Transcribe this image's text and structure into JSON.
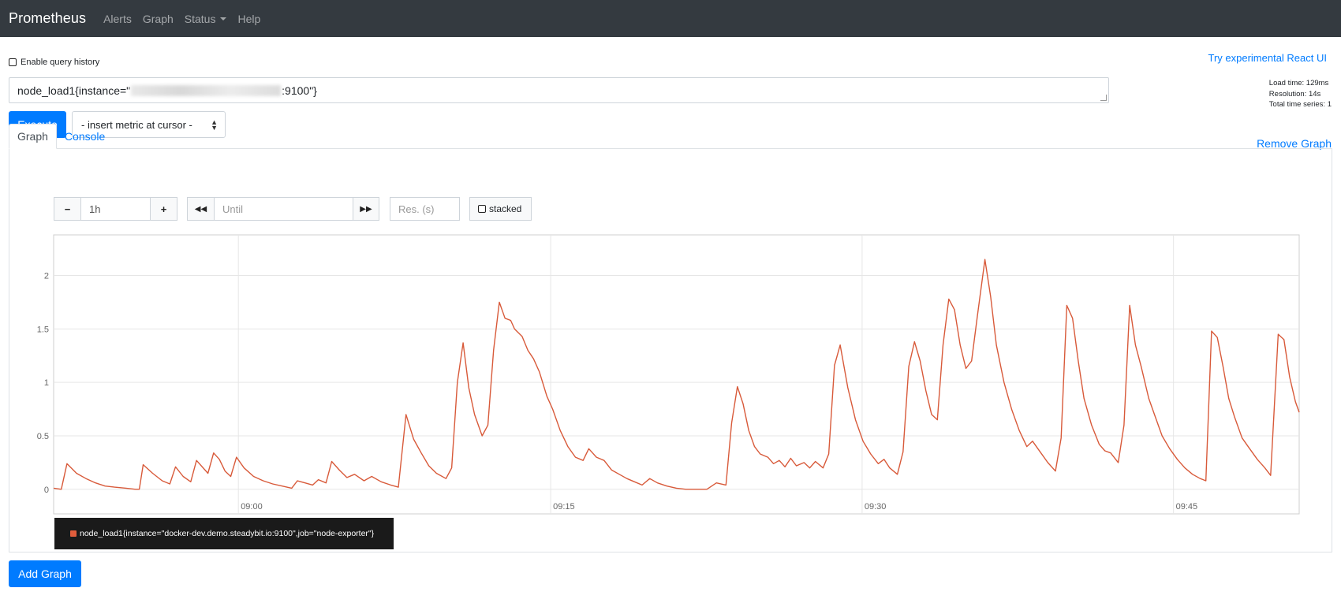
{
  "navbar": {
    "brand": "Prometheus",
    "links": [
      "Alerts",
      "Graph",
      "Status",
      "Help"
    ]
  },
  "query_history_label": "Enable query history",
  "react_ui_link": "Try experimental React UI",
  "stats": {
    "load_time": "Load time: 129ms",
    "resolution": "Resolution: 14s",
    "total_series": "Total time series: 1"
  },
  "expression": {
    "prefix": "node_load1{instance=\"",
    "suffix": ":9100\"}"
  },
  "execute_label": "Execute",
  "metric_select": "- insert metric at cursor -",
  "remove_graph_label": "Remove Graph",
  "tabs": [
    "Graph",
    "Console"
  ],
  "controls": {
    "range_value": "1h",
    "until_placeholder": "Until",
    "res_placeholder": "Res. (s)",
    "stacked_label": "stacked",
    "minus": "−",
    "plus": "+",
    "back": "◀◀",
    "forward": "▶▶"
  },
  "legend_label": "node_load1{instance=\"docker-dev.demo.steadybit.io:9100\",job=\"node-exporter\"}",
  "add_graph_label": "Add Graph",
  "colors": {
    "series": "#d85a3a",
    "accent": "#007bff",
    "navbar": "#343a40"
  },
  "chart_data": {
    "type": "line",
    "ylim": [
      -0.23,
      2.38
    ],
    "yticks": [
      0,
      0.5,
      1,
      1.5,
      2
    ],
    "ytick_labels": [
      "0",
      "0.5",
      "1",
      "1.5",
      "2"
    ],
    "xticks": [
      "09:00",
      "09:15",
      "09:30",
      "09:45"
    ],
    "series": [
      {
        "name": "node_load1{instance=\"docker-dev.demo.steadybit.io:9100\",job=\"node-exporter\"}",
        "points": [
          [
            0,
            0.01
          ],
          [
            0.4,
            0.0
          ],
          [
            0.7,
            0.24
          ],
          [
            1.2,
            0.15
          ],
          [
            1.7,
            0.1
          ],
          [
            2.2,
            0.06
          ],
          [
            2.7,
            0.03
          ],
          [
            3.2,
            0.02
          ],
          [
            3.8,
            0.01
          ],
          [
            4.3,
            0.0
          ],
          [
            4.5,
            0.0
          ],
          [
            4.7,
            0.23
          ],
          [
            5.2,
            0.15
          ],
          [
            5.7,
            0.08
          ],
          [
            6.1,
            0.05
          ],
          [
            6.4,
            0.21
          ],
          [
            6.8,
            0.12
          ],
          [
            7.2,
            0.07
          ],
          [
            7.5,
            0.27
          ],
          [
            8.1,
            0.15
          ],
          [
            8.4,
            0.34
          ],
          [
            8.7,
            0.28
          ],
          [
            9.0,
            0.17
          ],
          [
            9.3,
            0.12
          ],
          [
            9.6,
            0.3
          ],
          [
            10.0,
            0.2
          ],
          [
            10.5,
            0.12
          ],
          [
            11.0,
            0.08
          ],
          [
            11.5,
            0.05
          ],
          [
            12.0,
            0.03
          ],
          [
            12.5,
            0.01
          ],
          [
            12.8,
            0.08
          ],
          [
            13.2,
            0.06
          ],
          [
            13.6,
            0.04
          ],
          [
            13.9,
            0.09
          ],
          [
            14.3,
            0.06
          ],
          [
            14.6,
            0.26
          ],
          [
            15.0,
            0.18
          ],
          [
            15.4,
            0.11
          ],
          [
            15.8,
            0.14
          ],
          [
            16.3,
            0.08
          ],
          [
            16.7,
            0.12
          ],
          [
            17.2,
            0.07
          ],
          [
            17.7,
            0.04
          ],
          [
            18.1,
            0.02
          ],
          [
            18.5,
            0.7
          ],
          [
            18.9,
            0.47
          ],
          [
            19.3,
            0.34
          ],
          [
            19.7,
            0.22
          ],
          [
            20.1,
            0.15
          ],
          [
            20.6,
            0.1
          ],
          [
            20.9,
            0.2
          ],
          [
            21.2,
            1.0
          ],
          [
            21.5,
            1.37
          ],
          [
            21.8,
            0.95
          ],
          [
            22.1,
            0.7
          ],
          [
            22.5,
            0.5
          ],
          [
            22.8,
            0.6
          ],
          [
            23.1,
            1.3
          ],
          [
            23.4,
            1.75
          ],
          [
            23.7,
            1.6
          ],
          [
            24.0,
            1.58
          ],
          [
            24.2,
            1.5
          ],
          [
            24.6,
            1.43
          ],
          [
            24.9,
            1.3
          ],
          [
            25.2,
            1.22
          ],
          [
            25.5,
            1.1
          ],
          [
            25.9,
            0.87
          ],
          [
            26.2,
            0.75
          ],
          [
            26.6,
            0.55
          ],
          [
            27.0,
            0.4
          ],
          [
            27.4,
            0.3
          ],
          [
            27.8,
            0.27
          ],
          [
            28.1,
            0.38
          ],
          [
            28.5,
            0.3
          ],
          [
            28.9,
            0.27
          ],
          [
            29.3,
            0.18
          ],
          [
            29.7,
            0.14
          ],
          [
            30.1,
            0.1
          ],
          [
            30.5,
            0.07
          ],
          [
            30.9,
            0.04
          ],
          [
            31.3,
            0.1
          ],
          [
            31.7,
            0.06
          ],
          [
            32.2,
            0.03
          ],
          [
            32.7,
            0.01
          ],
          [
            33.2,
            0.0
          ],
          [
            33.8,
            0.0
          ],
          [
            34.3,
            0.0
          ],
          [
            34.8,
            0.06
          ],
          [
            35.3,
            0.04
          ],
          [
            35.6,
            0.62
          ],
          [
            35.9,
            0.96
          ],
          [
            36.2,
            0.8
          ],
          [
            36.5,
            0.55
          ],
          [
            36.8,
            0.4
          ],
          [
            37.1,
            0.33
          ],
          [
            37.5,
            0.3
          ],
          [
            37.8,
            0.24
          ],
          [
            38.1,
            0.27
          ],
          [
            38.4,
            0.21
          ],
          [
            38.7,
            0.29
          ],
          [
            39.0,
            0.22
          ],
          [
            39.4,
            0.25
          ],
          [
            39.7,
            0.2
          ],
          [
            40.0,
            0.26
          ],
          [
            40.4,
            0.2
          ],
          [
            40.7,
            0.33
          ],
          [
            41.0,
            1.16
          ],
          [
            41.3,
            1.35
          ],
          [
            41.7,
            0.95
          ],
          [
            42.1,
            0.65
          ],
          [
            42.5,
            0.45
          ],
          [
            42.9,
            0.33
          ],
          [
            43.3,
            0.24
          ],
          [
            43.6,
            0.28
          ],
          [
            43.9,
            0.2
          ],
          [
            44.3,
            0.14
          ],
          [
            44.6,
            0.35
          ],
          [
            44.9,
            1.15
          ],
          [
            45.2,
            1.38
          ],
          [
            45.5,
            1.2
          ],
          [
            45.8,
            0.92
          ],
          [
            46.1,
            0.7
          ],
          [
            46.4,
            0.65
          ],
          [
            46.7,
            1.35
          ],
          [
            47.0,
            1.78
          ],
          [
            47.3,
            1.68
          ],
          [
            47.6,
            1.35
          ],
          [
            47.9,
            1.13
          ],
          [
            48.2,
            1.2
          ],
          [
            48.5,
            1.62
          ],
          [
            48.9,
            2.15
          ],
          [
            49.2,
            1.8
          ],
          [
            49.5,
            1.35
          ],
          [
            49.9,
            1.0
          ],
          [
            50.3,
            0.75
          ],
          [
            50.7,
            0.55
          ],
          [
            51.1,
            0.4
          ],
          [
            51.4,
            0.45
          ],
          [
            51.8,
            0.35
          ],
          [
            52.2,
            0.25
          ],
          [
            52.6,
            0.17
          ],
          [
            52.9,
            0.48
          ],
          [
            53.2,
            1.72
          ],
          [
            53.5,
            1.6
          ],
          [
            53.8,
            1.2
          ],
          [
            54.1,
            0.85
          ],
          [
            54.5,
            0.6
          ],
          [
            54.9,
            0.42
          ],
          [
            55.2,
            0.36
          ],
          [
            55.5,
            0.34
          ],
          [
            55.9,
            0.25
          ],
          [
            56.2,
            0.6
          ],
          [
            56.5,
            1.72
          ],
          [
            56.8,
            1.35
          ],
          [
            57.1,
            1.15
          ],
          [
            57.5,
            0.85
          ],
          [
            57.8,
            0.7
          ],
          [
            58.2,
            0.5
          ],
          [
            58.6,
            0.38
          ],
          [
            59.0,
            0.28
          ],
          [
            59.4,
            0.2
          ],
          [
            59.8,
            0.14
          ],
          [
            60.2,
            0.1
          ],
          [
            60.5,
            0.08
          ],
          [
            60.8,
            1.48
          ],
          [
            61.1,
            1.42
          ],
          [
            61.4,
            1.15
          ],
          [
            61.7,
            0.85
          ],
          [
            62.0,
            0.68
          ],
          [
            62.4,
            0.48
          ],
          [
            62.8,
            0.38
          ],
          [
            63.2,
            0.28
          ],
          [
            63.6,
            0.2
          ],
          [
            63.9,
            0.13
          ],
          [
            64.3,
            1.45
          ],
          [
            64.6,
            1.4
          ],
          [
            64.9,
            1.05
          ],
          [
            65.2,
            0.82
          ],
          [
            65.4,
            0.72
          ]
        ]
      }
    ]
  }
}
